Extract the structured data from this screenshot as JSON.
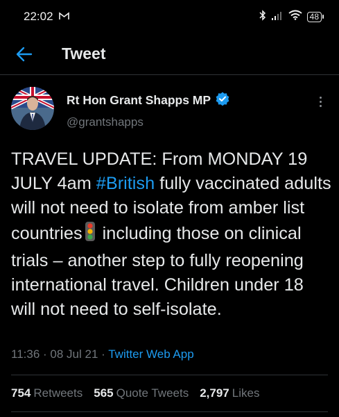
{
  "status_bar": {
    "time": "22:02",
    "battery": "48"
  },
  "header": {
    "title": "Tweet"
  },
  "author": {
    "name": "Rt Hon Grant Shapps MP",
    "handle": "@grantshapps"
  },
  "tweet": {
    "text_before": "TRAVEL UPDATE: From MONDAY 19 JULY 4am ",
    "hashtag": "#British",
    "text_middle": " fully vaccinated adults will not need to isolate from amber list countries",
    "text_after": " including those on clinical trials – another step to fully reopening international travel. Children under 18 will not need to self-isolate."
  },
  "meta": {
    "time": "11:36",
    "date": "08 Jul 21",
    "source": "Twitter Web App"
  },
  "stats": {
    "retweets_count": "754",
    "retweets_label": "Retweets",
    "quotes_count": "565",
    "quotes_label": "Quote Tweets",
    "likes_count": "2,797",
    "likes_label": "Likes"
  },
  "colors": {
    "background": "#000000",
    "accent": "#1d9bf0",
    "muted": "#71767b",
    "divider": "#2f3336"
  }
}
